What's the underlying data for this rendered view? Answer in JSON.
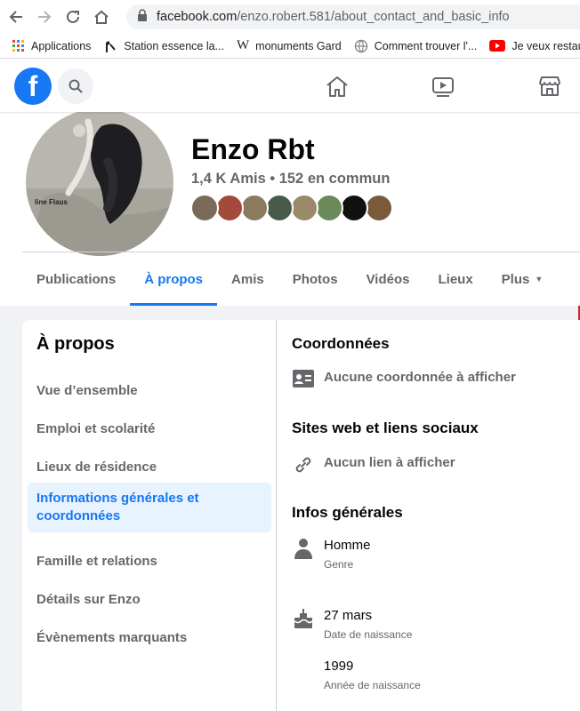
{
  "browser": {
    "url_host": "facebook.com",
    "url_path": "/enzo.robert.581/about_contact_and_basic_info",
    "bookmarks": [
      {
        "label": "Applications",
        "icon": "apps-grid-icon"
      },
      {
        "label": "Station essence la...",
        "icon": "fuel-pump-icon"
      },
      {
        "label": "monuments Gard",
        "icon": "wikipedia-icon"
      },
      {
        "label": "Comment trouver l'...",
        "icon": "globe-icon"
      },
      {
        "label": "Je veux restaur",
        "icon": "youtube-icon"
      }
    ]
  },
  "profile": {
    "name": "Enzo Rbt",
    "friends_summary": "1,4 K Amis • 152 en commun",
    "avatar_caption": "line Flaus",
    "friend_avatar_colors": [
      "#7a6a58",
      "#a34a3a",
      "#8a7a5e",
      "#4a5a4a",
      "#9a8a6a",
      "#6b8a5a",
      "#111111",
      "#7a5a3a"
    ]
  },
  "tabs": [
    "Publications",
    "À propos",
    "Amis",
    "Photos",
    "Vidéos",
    "Lieux",
    "Plus"
  ],
  "about_menu": {
    "title": "À propos",
    "items": [
      "Vue d’ensemble",
      "Emploi et scolarité",
      "Lieux de résidence",
      "Informations générales et coordonnées",
      "Famille et relations",
      "Détails sur Enzo",
      "Évènements marquants"
    ]
  },
  "details": {
    "contact_heading": "Coordonnées",
    "contact_empty": "Aucune coordonnée à afficher",
    "web_heading": "Sites web et liens sociaux",
    "web_empty": "Aucun lien à afficher",
    "general_heading": "Infos générales",
    "gender_value": "Homme",
    "gender_label": "Genre",
    "birthday_value": "27 mars",
    "birthday_label": "Date de naissance",
    "birthyear_value": "1999",
    "birthyear_label": "Année de naissance"
  },
  "colors": {
    "accent": "#1877f2",
    "accent_bg": "#e7f3ff",
    "secondary_text": "#65676b"
  }
}
